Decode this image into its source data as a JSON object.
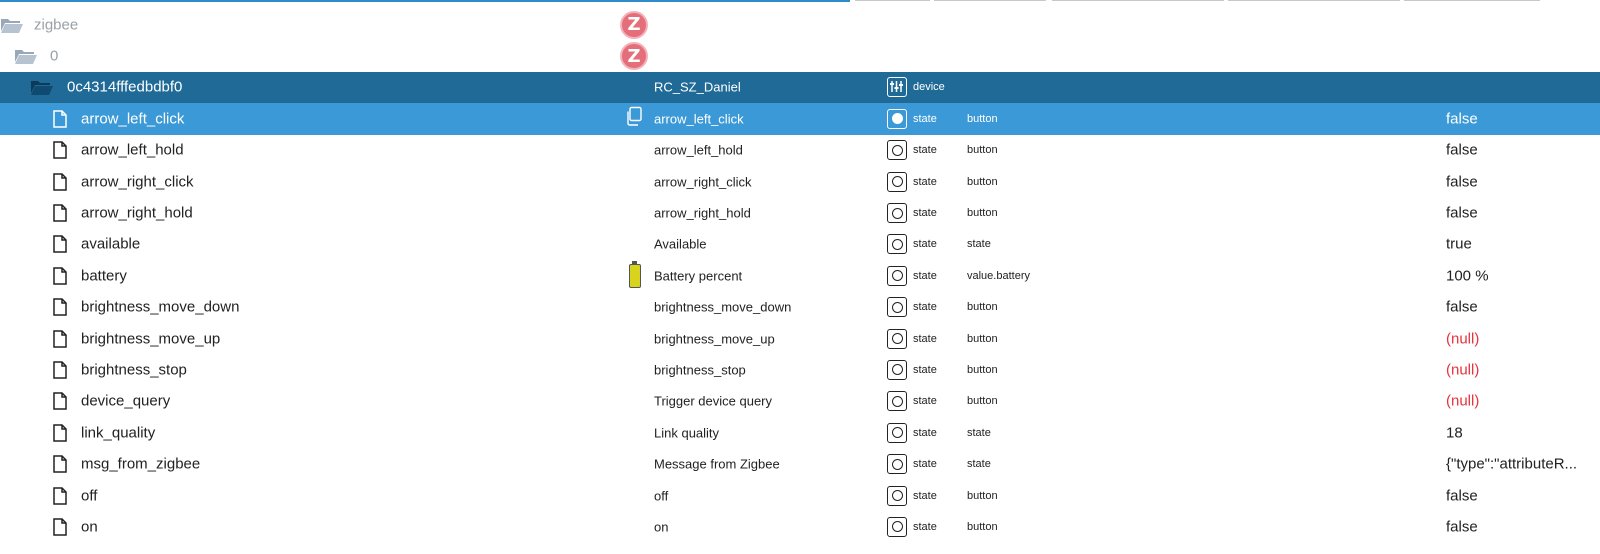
{
  "tree": {
    "root": {
      "label": "zigbee",
      "icon": "folder-open-icon",
      "logo": "Z"
    },
    "instance": {
      "label": "0",
      "icon": "folder-open-icon",
      "logo": "Z"
    },
    "device": {
      "id": "0c4314fffedbdbf0",
      "name": "RC_SZ_Daniel",
      "type": "device"
    },
    "states": [
      {
        "id": "arrow_left_click",
        "name": "arrow_left_click",
        "type": "state",
        "role": "button",
        "value": "false",
        "selected": true
      },
      {
        "id": "arrow_left_hold",
        "name": "arrow_left_hold",
        "type": "state",
        "role": "button",
        "value": "false"
      },
      {
        "id": "arrow_right_click",
        "name": "arrow_right_click",
        "type": "state",
        "role": "button",
        "value": "false"
      },
      {
        "id": "arrow_right_hold",
        "name": "arrow_right_hold",
        "type": "state",
        "role": "button",
        "value": "false"
      },
      {
        "id": "available",
        "name": "Available",
        "type": "state",
        "role": "state",
        "value": "true"
      },
      {
        "id": "battery",
        "name": "Battery percent",
        "type": "state",
        "role": "value.battery",
        "value": "100 %"
      },
      {
        "id": "brightness_move_down",
        "name": "brightness_move_down",
        "type": "state",
        "role": "button",
        "value": "false"
      },
      {
        "id": "brightness_move_up",
        "name": "brightness_move_up",
        "type": "state",
        "role": "button",
        "value": "(null)"
      },
      {
        "id": "brightness_stop",
        "name": "brightness_stop",
        "type": "state",
        "role": "button",
        "value": "(null)"
      },
      {
        "id": "device_query",
        "name": "Trigger device query",
        "type": "state",
        "role": "button",
        "value": "(null)"
      },
      {
        "id": "link_quality",
        "name": "Link quality",
        "type": "state",
        "role": "state",
        "value": "18"
      },
      {
        "id": "msg_from_zigbee",
        "name": "Message from Zigbee",
        "type": "state",
        "role": "state",
        "value": "{\"type\":\"attributeR..."
      },
      {
        "id": "off",
        "name": "off",
        "type": "state",
        "role": "button",
        "value": "false"
      },
      {
        "id": "on",
        "name": "on",
        "type": "state",
        "role": "button",
        "value": "false"
      }
    ]
  },
  "colors": {
    "device_row": "#1f6a96",
    "selected_row": "#3a99d6",
    "null_value": "#e8323d",
    "zigbee_logo": "#e46e7a"
  }
}
